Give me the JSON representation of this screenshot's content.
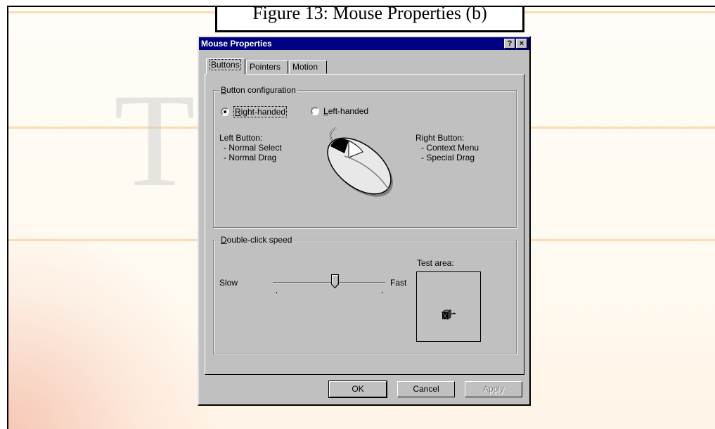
{
  "caption": "Figure 13: Mouse Properties (b)",
  "dialog": {
    "title": "Mouse Properties",
    "help_label": "?",
    "close_label": "×",
    "tabs": [
      {
        "label": "Buttons",
        "active": true
      },
      {
        "label": "Pointers",
        "active": false
      },
      {
        "label": "Motion",
        "active": false
      }
    ],
    "button_config": {
      "group_label_first": "B",
      "group_label_rest": "utton configuration",
      "right_handed_first": "R",
      "right_handed_rest": "ight-handed",
      "left_handed_first": "L",
      "left_handed_rest": "eft-handed",
      "selected": "right-handed",
      "left_button_title": "Left Button:",
      "left_button_items": [
        "- Normal Select",
        "- Normal Drag"
      ],
      "right_button_title": "Right Button:",
      "right_button_items": [
        "- Context Menu",
        "- Special Drag"
      ]
    },
    "double_click": {
      "group_label_first": "D",
      "group_label_rest": "ouble-click speed",
      "slow_label": "Slow",
      "fast_label": "Fast",
      "slider_level": 0.55,
      "test_area_label": "Test area:"
    },
    "buttons": {
      "ok": "OK",
      "cancel": "Cancel",
      "apply": "Apply"
    }
  }
}
